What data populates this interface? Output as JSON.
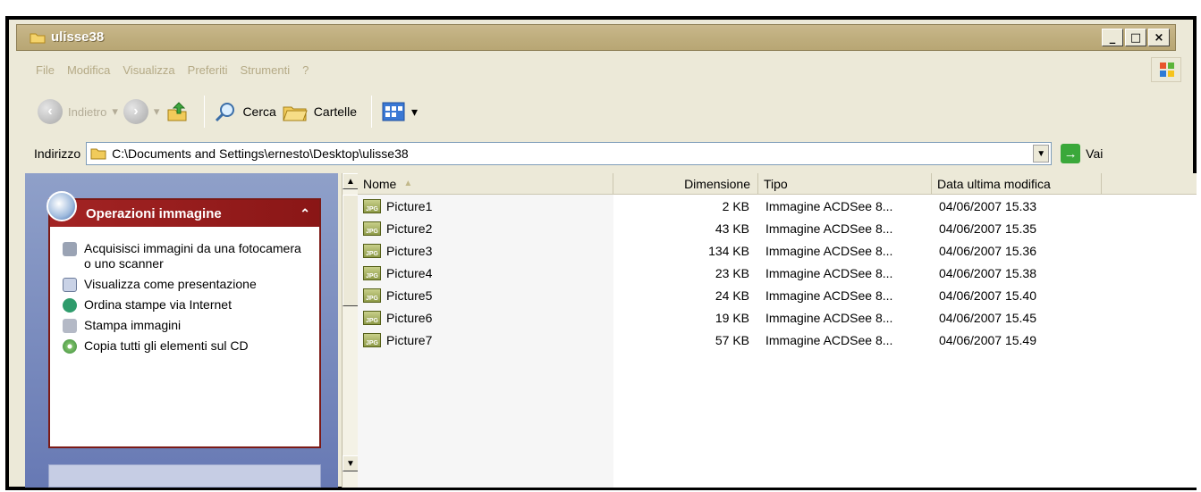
{
  "window": {
    "title": "ulisse38"
  },
  "menu": [
    "File",
    "Modifica",
    "Visualizza",
    "Preferiti",
    "Strumenti",
    "?"
  ],
  "toolbar": {
    "back_label": "Indietro",
    "search_label": "Cerca",
    "folders_label": "Cartelle"
  },
  "address": {
    "label": "Indirizzo",
    "value": "C:\\Documents and Settings\\ernesto\\Desktop\\ulisse38",
    "go_label": "Vai"
  },
  "task_panel": {
    "title": "Operazioni immagine",
    "items": [
      {
        "label": "Acquisisci immagini da una fotocamera o uno scanner",
        "icon": "camera-icon"
      },
      {
        "label": "Visualizza come presentazione",
        "icon": "slideshow-icon"
      },
      {
        "label": "Ordina stampe via Internet",
        "icon": "web-print-icon"
      },
      {
        "label": "Stampa immagini",
        "icon": "printer-icon"
      },
      {
        "label": "Copia tutti gli elementi sul CD",
        "icon": "cd-icon"
      }
    ]
  },
  "columns": {
    "name": "Nome",
    "size": "Dimensione",
    "type": "Tipo",
    "date": "Data ultima modifica"
  },
  "files": [
    {
      "name": "Picture1",
      "size": "2 KB",
      "type": "Immagine ACDSee 8...",
      "date": "04/06/2007 15.33"
    },
    {
      "name": "Picture2",
      "size": "43 KB",
      "type": "Immagine ACDSee 8...",
      "date": "04/06/2007 15.35"
    },
    {
      "name": "Picture3",
      "size": "134 KB",
      "type": "Immagine ACDSee 8...",
      "date": "04/06/2007 15.36"
    },
    {
      "name": "Picture4",
      "size": "23 KB",
      "type": "Immagine ACDSee 8...",
      "date": "04/06/2007 15.38"
    },
    {
      "name": "Picture5",
      "size": "24 KB",
      "type": "Immagine ACDSee 8...",
      "date": "04/06/2007 15.40"
    },
    {
      "name": "Picture6",
      "size": "19 KB",
      "type": "Immagine ACDSee 8...",
      "date": "04/06/2007 15.45"
    },
    {
      "name": "Picture7",
      "size": "57 KB",
      "type": "Immagine ACDSee 8...",
      "date": "04/06/2007 15.49"
    }
  ]
}
